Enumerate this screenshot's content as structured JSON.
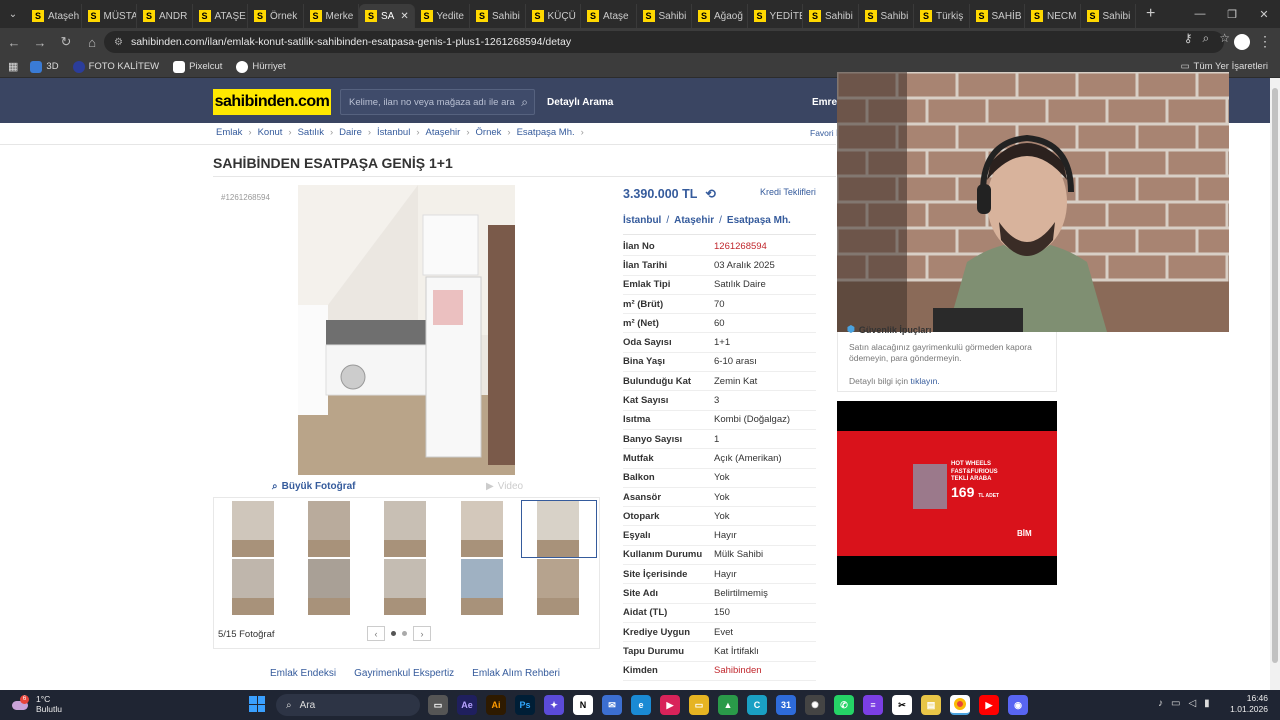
{
  "browser": {
    "tabs": [
      {
        "label": "Ataşeh",
        "icon": "S"
      },
      {
        "label": "MÜSTA",
        "icon": "S"
      },
      {
        "label": "ANDR",
        "icon": "S"
      },
      {
        "label": "ATAŞE",
        "icon": "S"
      },
      {
        "label": "Örnek",
        "icon": "S"
      },
      {
        "label": "Merke",
        "icon": "S"
      },
      {
        "label": "SA",
        "icon": "S",
        "active": true
      },
      {
        "label": "Yedite",
        "icon": "S"
      },
      {
        "label": "Sahibi",
        "icon": "S"
      },
      {
        "label": "KÜÇÜ",
        "icon": "S"
      },
      {
        "label": "Ataşe",
        "icon": "S"
      },
      {
        "label": "Sahibi",
        "icon": "S"
      },
      {
        "label": "Ağaoğ",
        "icon": "S"
      },
      {
        "label": "YEDİTE",
        "icon": "S"
      },
      {
        "label": "Sahibi",
        "icon": "S"
      },
      {
        "label": "Sahibi",
        "icon": "S"
      },
      {
        "label": "Türkiş",
        "icon": "S"
      },
      {
        "label": "SAHİB",
        "icon": "S"
      },
      {
        "label": "NECM",
        "icon": "S"
      },
      {
        "label": "Sahibi",
        "icon": "S"
      }
    ],
    "url": "sahibinden.com/ilan/emlak-konut-satilik-sahibinden-esatpasa-genis-1-plus1-1261268594/detay",
    "bookmarks": [
      "3D",
      "FOTO KALİTEW",
      "Pixelcut",
      "Hürriyet"
    ],
    "all_bookmarks": "Tüm Yer İşaretleri"
  },
  "site": {
    "logo": "sahibinden.com",
    "search_placeholder": "Kelime, ilan no veya mağaza adı ile ara",
    "detailed_search": "Detaylı Arama",
    "user": "Emre E",
    "favorites": "Favori İ"
  },
  "breadcrumbs": [
    "Emlak",
    "Konut",
    "Satılık",
    "Daire",
    "İstanbul",
    "Ataşehir",
    "Örnek",
    "Esatpaşa Mh."
  ],
  "listing": {
    "title": "SAHİBİNDEN ESATPAŞA GENİŞ 1+1",
    "id_mini": "#1261268594",
    "big_photo": "Büyük Fotoğraf",
    "video": "Video",
    "photo_count": "5/15 Fotoğraf",
    "price": "3.390.000 TL",
    "credit": "Kredi Teklifleri",
    "location": [
      "İstanbul",
      "Ataşehir",
      "Esatpaşa Mh."
    ],
    "details": [
      {
        "k": "İlan No",
        "v": "1261268594",
        "red": true
      },
      {
        "k": "İlan Tarihi",
        "v": "03 Aralık 2025"
      },
      {
        "k": "Emlak Tipi",
        "v": "Satılık Daire"
      },
      {
        "k": "m² (Brüt)",
        "v": "70"
      },
      {
        "k": "m² (Net)",
        "v": "60"
      },
      {
        "k": "Oda Sayısı",
        "v": "1+1"
      },
      {
        "k": "Bina Yaşı",
        "v": "6-10 arası"
      },
      {
        "k": "Bulunduğu Kat",
        "v": "Zemin Kat"
      },
      {
        "k": "Kat Sayısı",
        "v": "3"
      },
      {
        "k": "Isıtma",
        "v": "Kombi (Doğalgaz)"
      },
      {
        "k": "Banyo Sayısı",
        "v": "1"
      },
      {
        "k": "Mutfak",
        "v": "Açık (Amerikan)"
      },
      {
        "k": "Balkon",
        "v": "Yok"
      },
      {
        "k": "Asansör",
        "v": "Yok"
      },
      {
        "k": "Otopark",
        "v": "Yok"
      },
      {
        "k": "Eşyalı",
        "v": "Hayır"
      },
      {
        "k": "Kullanım Durumu",
        "v": "Mülk Sahibi"
      },
      {
        "k": "Site İçerisinde",
        "v": "Hayır"
      },
      {
        "k": "Site Adı",
        "v": "Belirtilmemiş"
      },
      {
        "k": "Aidat (TL)",
        "v": "150"
      },
      {
        "k": "Krediye Uygun",
        "v": "Evet"
      },
      {
        "k": "Tapu Durumu",
        "v": "Kat İrtifaklı"
      },
      {
        "k": "Kimden",
        "v": "Sahibinden",
        "red": true
      }
    ]
  },
  "bottom_links": [
    "Emlak Endeksi",
    "Gayrimenkul Ekspertiz",
    "Emlak Alım Rehberi"
  ],
  "safety": {
    "title": "Güvenlik İpuçları",
    "text": "Satın alacağınız gayrimenkulü görmeden kapora ödemeyin, para göndermeyin.",
    "more": "Detaylı bilgi için",
    "link": "tıklayın."
  },
  "ad": {
    "brand": "HOT WHEELS",
    "line1": "FAST&FURIOUS",
    "line2": "TEKLİ ARABA",
    "price": "169",
    "unit": "TL ADET",
    "store": "BİM"
  },
  "taskbar": {
    "temp": "1°C",
    "weather": "Bulutlu",
    "weather_badge": "6",
    "search": "Ara",
    "time": "16:46",
    "date": "1.01.2026"
  }
}
